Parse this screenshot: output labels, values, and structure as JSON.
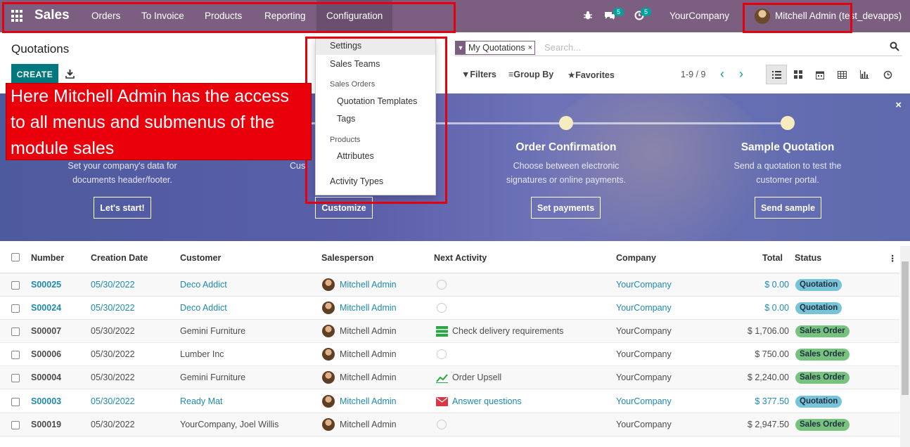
{
  "navbar": {
    "brand": "Sales",
    "menus": [
      "Orders",
      "To Invoice",
      "Products",
      "Reporting",
      "Configuration"
    ],
    "messages_badge": "5",
    "activities_badge": "5",
    "company": "YourCompany",
    "user": "Mitchell Admin (test_devapps)"
  },
  "control_panel": {
    "title": "Quotations",
    "create_label": "CREATE",
    "facet_label": "My Quotations",
    "facet_remove": "×",
    "search_placeholder": "Search...",
    "filters_label": "Filters",
    "group_by_label": "Group By",
    "favorites_label": "Favorites",
    "pager": "1-9 / 9"
  },
  "dropdown": {
    "items": [
      "Settings",
      "Sales Teams"
    ],
    "section_sales_orders": "Sales Orders",
    "sales_orders_items": [
      "Quotation Templates",
      "Tags"
    ],
    "section_products": "Products",
    "products_items": [
      "Attributes"
    ],
    "activity_types": "Activity Types"
  },
  "callout": "Here Mitchell Admin has the access to all menus and submenus of the module sales",
  "banner": {
    "steps": [
      {
        "title": "",
        "desc_line1": "Set your company's data for",
        "desc_line2": "documents header/footer.",
        "button": "Let's start!"
      },
      {
        "title": "",
        "desc_line1": "Cus",
        "desc_line2": "",
        "button": "Customize"
      },
      {
        "title": "Order Confirmation",
        "desc_line1": "Choose between electronic",
        "desc_line2": "signatures or online payments.",
        "button": "Set payments"
      },
      {
        "title": "Sample Quotation",
        "desc_line1": "Send a quotation to test the",
        "desc_line2": "customer portal.",
        "button": "Send sample"
      }
    ],
    "close": "×"
  },
  "table": {
    "headers": [
      "Number",
      "Creation Date",
      "Customer",
      "Salesperson",
      "Next Activity",
      "Company",
      "Total",
      "Status"
    ],
    "rows": [
      {
        "number": "S00025",
        "date": "05/30/2022",
        "customer": "Deco Addict",
        "salesperson": "Mitchell Admin",
        "activity": "",
        "company": "YourCompany",
        "total": "$ 0.00",
        "status": "Quotation"
      },
      {
        "number": "S00024",
        "date": "05/30/2022",
        "customer": "Deco Addict",
        "salesperson": "Mitchell Admin",
        "activity": "",
        "company": "YourCompany",
        "total": "$ 0.00",
        "status": "Quotation"
      },
      {
        "number": "S00007",
        "date": "05/30/2022",
        "customer": "Gemini Furniture",
        "salesperson": "Mitchell Admin",
        "activity": "Check delivery requirements",
        "company": "YourCompany",
        "total": "$ 1,706.00",
        "status": "Sales Order"
      },
      {
        "number": "S00006",
        "date": "05/30/2022",
        "customer": "Lumber Inc",
        "salesperson": "Mitchell Admin",
        "activity": "",
        "company": "YourCompany",
        "total": "$ 750.00",
        "status": "Sales Order"
      },
      {
        "number": "S00004",
        "date": "05/30/2022",
        "customer": "Gemini Furniture",
        "salesperson": "Mitchell Admin",
        "activity": "Order Upsell",
        "company": "YourCompany",
        "total": "$ 2,240.00",
        "status": "Sales Order"
      },
      {
        "number": "S00003",
        "date": "05/30/2022",
        "customer": "Ready Mat",
        "salesperson": "Mitchell Admin",
        "activity": "Answer questions",
        "company": "YourCompany",
        "total": "$ 377.50",
        "status": "Quotation"
      },
      {
        "number": "S00019",
        "date": "05/30/2022",
        "customer": "YourCompany, Joel Willis",
        "salesperson": "Mitchell Admin",
        "activity": "",
        "company": "YourCompany",
        "total": "$ 2,947.50",
        "status": "Sales Order"
      }
    ]
  }
}
